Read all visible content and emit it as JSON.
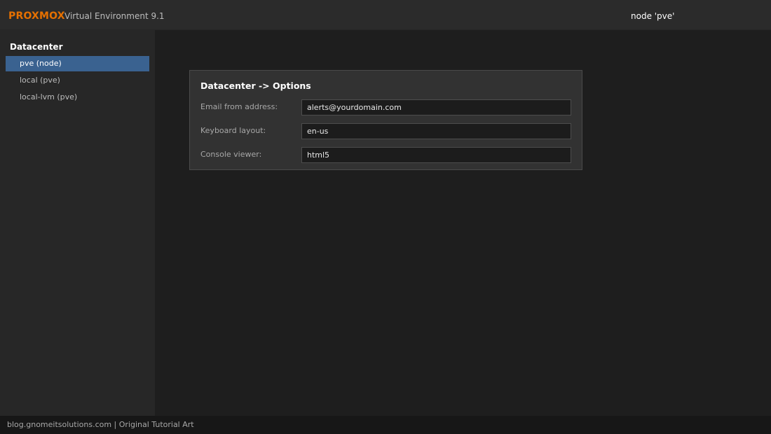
{
  "header": {
    "logo": "PROXMOX",
    "product": "Virtual Environment 9.1",
    "node": "node 'pve'"
  },
  "sidebar": {
    "root": "Datacenter",
    "items": [
      {
        "label": "pve (node)",
        "selected": true
      },
      {
        "label": "local (pve)",
        "selected": false
      },
      {
        "label": "local-lvm (pve)",
        "selected": false
      }
    ]
  },
  "panel": {
    "title": "Datacenter -> Options",
    "fields": [
      {
        "label": "Email from address:",
        "value": "alerts@yourdomain.com"
      },
      {
        "label": "Keyboard layout:",
        "value": "en-us"
      },
      {
        "label": "Console viewer:",
        "value": "html5"
      }
    ]
  },
  "footer": {
    "text": "blog.gnomeitsolutions.com | Original Tutorial Art"
  },
  "colors": {
    "accent": "#e57000",
    "selection": "#3a6290"
  }
}
